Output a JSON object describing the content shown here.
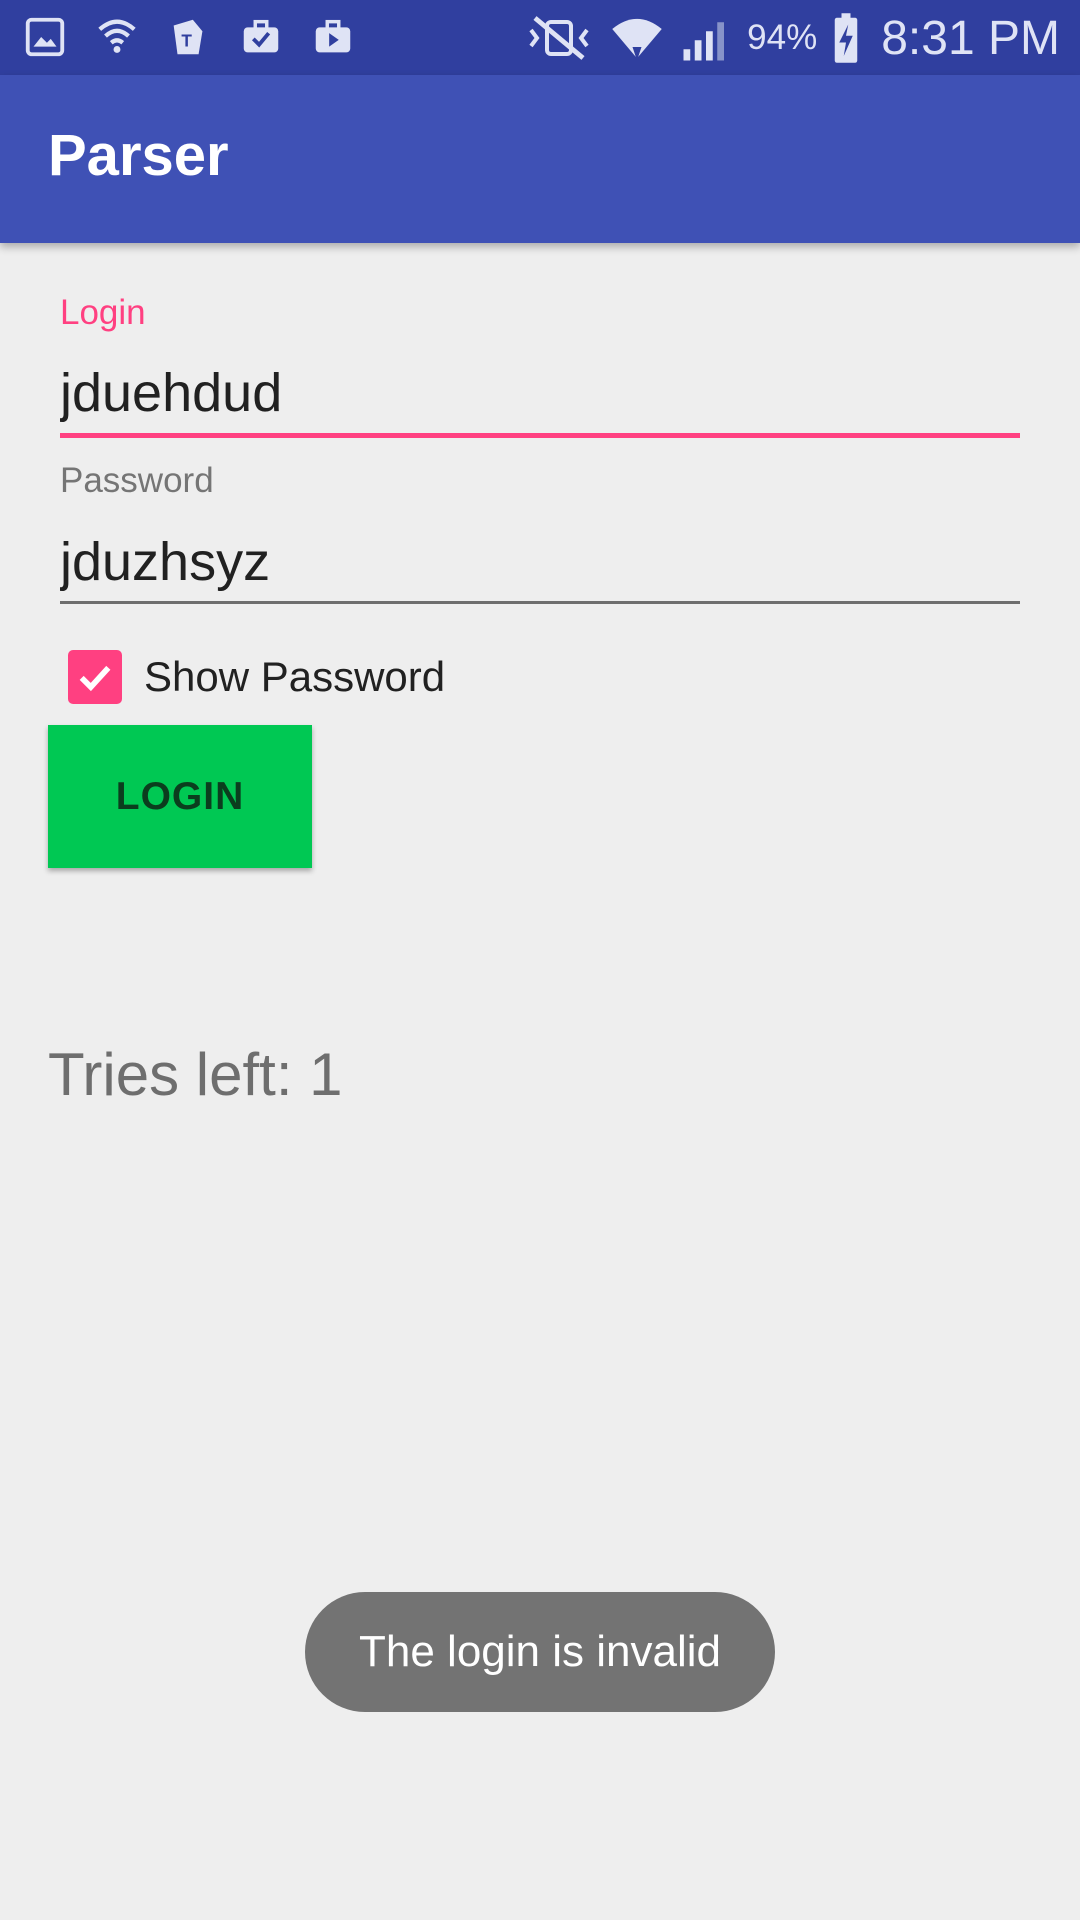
{
  "status_bar": {
    "left_icons": [
      "gallery-icon",
      "wifi-calling-icon",
      "t-mobile-icon",
      "briefcase-check-icon",
      "briefcase-play-icon"
    ],
    "right_icons": [
      "mute-vibrate-icon",
      "wifi-icon",
      "cell-signal-icon",
      "battery-charging-icon"
    ],
    "battery_percent": "94%",
    "time": "8:31 PM"
  },
  "app_bar": {
    "title": "Parser",
    "color": "#3f51b5",
    "status_color": "#303f9f"
  },
  "form": {
    "login": {
      "label": "Login",
      "value": "jduehdud",
      "focused": true
    },
    "password": {
      "label": "Password",
      "value": "jduzhsyz",
      "focused": false
    },
    "show_password": {
      "label": "Show Password",
      "checked": true
    },
    "login_button": "LOGIN"
  },
  "tries_left": "Tries left: 1",
  "toast": "The login is invalid",
  "colors": {
    "accent": "#ff4081",
    "button": "#00c853",
    "background": "#eeeeee"
  }
}
